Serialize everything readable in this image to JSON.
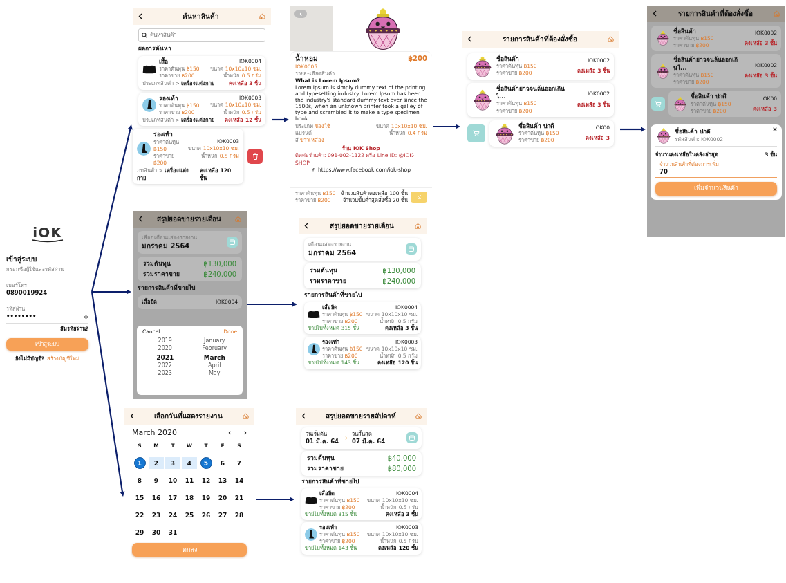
{
  "login": {
    "logo": "iOK",
    "title": "เข้าสู่ระบบ",
    "subtitle": "กรอกชื่อผู้ใช้และรหัสผ่าน",
    "phone_label": "เบอร์โทร",
    "phone": "0890019924",
    "password_label": "รหัสผ่าน",
    "password": "••••••••",
    "forgot": "ลืมรหัสผ่าน?",
    "button": "เข้าสู่ระบบ",
    "signup_text": "ยังไม่มีบัญชี?",
    "signup_link": "สร้างบัญชีใหม่"
  },
  "search_screen": {
    "title": "ค้นหาสินค้า",
    "search_placeholder": "ค้นหาสินค้า",
    "section": "ผลการค้นหา",
    "products": [
      {
        "kind": "shirt",
        "name": "เสื้อ",
        "code": "IOK0004",
        "cost_label": "ราคาต้นทุน",
        "cost": "฿150",
        "price_label": "ราคาขาย",
        "price": "฿200",
        "size_label": "ขนาด",
        "size": "10x10x10 ซม.",
        "weight_label": "น้ำหนัก",
        "weight": "0.5 กรัม",
        "category_label": "ประเภทสินค้า >",
        "category": "เครื่องแต่งกาย",
        "stock": "คงเหลือ 3 ชิ้น",
        "low_stock": true,
        "swiped": false
      },
      {
        "kind": "shoe",
        "name": "รองเท้า",
        "code": "IOK0003",
        "cost_label": "ราคาต้นทุน",
        "cost": "฿150",
        "price_label": "ราคาขาย",
        "price": "฿200",
        "size_label": "ขนาด",
        "size": "10x10x10 ซม.",
        "weight_label": "น้ำหนัก",
        "weight": "0.5 กรัม",
        "category_label": "ประเภทสินค้า >",
        "category": "เครื่องแต่งกาย",
        "stock": "คงเหลือ 12 ชิ้น",
        "low_stock": true,
        "swiped": false
      },
      {
        "kind": "shoe",
        "name": "รองเท้า",
        "code": "IOK0003",
        "cost_label": "ราคาต้นทุน",
        "cost": "฿150",
        "price_label": "ราคาขาย",
        "price": "฿200",
        "size_label": "ขนาด",
        "size": "10x10x10 ซม.",
        "weight_label": "น้ำหนัก",
        "weight": "0.5 กรัม",
        "category_label": "ภทสินค้า >",
        "category": "เครื่องแต่งกาย",
        "stock": "คงเหลือ 120 ชิ้น",
        "low_stock": false,
        "swiped": true
      }
    ]
  },
  "detail_screen": {
    "name": "น้ำหอม",
    "code": "IOK0005",
    "price": "฿200",
    "description_label": "รายละเอียดสินค้า",
    "description_title": "What is Lorem Ipsum?",
    "description": "Lorem Ipsum is simply dummy text of the printing and typesetting industry. Lorem Ipsum has been the industry's standard dummy text ever since the 1500s, when an unknown printer took a galley of type and scrambled it to make a type specimen book.",
    "type_label": "ประเภท",
    "type": "ของใช้",
    "brand_label": "แบรนด์",
    "variant_label": "สี",
    "variant": "ขาวเหลือง",
    "size_label": "ขนาด",
    "size": "10x10x10 ซม.",
    "weight_label": "น้ำหนัก",
    "weight": "0.4 กรัม",
    "shop": "ร้าน IOK Shop",
    "contact": "ติดต่อร้านค้า: 091-002-1122 หรือ Line ID: @IOK-SHOP",
    "facebook": "https://www.facebook.com/iok-shop",
    "cost_label": "ราคาต้นทุน",
    "cost": "฿150",
    "sale_label": "ราคาขาย",
    "sale": "฿200",
    "stock_text": "จำนวนสินค้าคงเหลือ 100 ชิ้น",
    "min_order_text": "จำนวนขั้นต่ำสุดสั่งซื้อ 20 ชิ้น"
  },
  "order_screen": {
    "title": "รายการสินค้าที่ต้องสั่งซื้อ",
    "items": [
      {
        "name": "ชื่อสินค้า",
        "code": "IOK0002",
        "cost_label": "ราคาต้นทุน",
        "cost": "฿150",
        "price_label": "ราคาขาย",
        "price": "฿200",
        "stock": "คงเหลือ 3 ชิ้น",
        "swiped": false
      },
      {
        "name": "ชื่อสินค้ายาวจนล้นออกเกินไ...",
        "code": "IOK0002",
        "cost_label": "ราคาต้นทุน",
        "cost": "฿150",
        "price_label": "ราคาขาย",
        "price": "฿200",
        "stock": "คงเหลือ 3 ชิ้น",
        "swiped": false
      },
      {
        "name": "ชื่อสินค้า ปกติ",
        "code": "IOK00",
        "cost_label": "ราคาต้นทุน",
        "cost": "฿150",
        "price_label": "ราคาขาย",
        "price": "฿200",
        "stock": "คงเหลือ 3",
        "swiped": true
      }
    ]
  },
  "restock_screen": {
    "title": "รายการสินค้าที่ต้องสั่งซื้อ",
    "items": [
      {
        "name": "ชื่อสินค้า",
        "code": "IOK0002",
        "cost_label": "ราคาต้นทุน",
        "cost": "฿150",
        "price_label": "ราคาขาย",
        "price": "฿200",
        "stock": "คงเหลือ 3 ชิ้น",
        "swiped": false
      },
      {
        "name": "ชื่อสินค้ายาวจนล้นออกเกินไ...",
        "code": "IOK0002",
        "cost_label": "ราคาต้นทุน",
        "cost": "฿150",
        "price_label": "ราคาขาย",
        "price": "฿200",
        "stock": "คงเหลือ 3 ชิ้น",
        "swiped": false
      },
      {
        "name": "ชื่อสินค้า ปกติ",
        "code": "IOK00",
        "cost_label": "ราคาต้นทุน",
        "cost": "฿150",
        "price_label": "ราคาขาย",
        "price": "฿200",
        "stock": "คงเหลือ 3",
        "swiped": true
      }
    ],
    "modal": {
      "name": "ชื่อสินค้า ปกติ",
      "code_text": "รหัสสินค้า: IOK0002",
      "stock_label": "จำนวนคงเหลือในคลังล่าสุด",
      "stock": "3 ชิ้น",
      "input_label": "จำนวนสินค้าที่ต้องการเพิ่ม",
      "input_value": "70",
      "button": "เพิ่มจำนวนสินค้า"
    }
  },
  "month_picker_screen": {
    "title": "สรุปยอดขายรายเดือน",
    "month_label": "เลือกเดือนแสดงรายงาน",
    "month": "มกราคม 2564",
    "cost_label": "รวมต้นทุน",
    "cost": "฿130,000",
    "sale_label": "รวมราคาขาย",
    "sale": "฿240,000",
    "section": "รายการสินค้าที่ขายไป",
    "peek_name": "เสื้อยืด",
    "peek_code": "IOK0004",
    "cancel": "Cancel",
    "done": "Done",
    "years": [
      {
        "label": "2019",
        "selected": false
      },
      {
        "label": "2020",
        "selected": false
      },
      {
        "label": "2021",
        "selected": true
      },
      {
        "label": "2022",
        "selected": false
      },
      {
        "label": "2023",
        "selected": false
      }
    ],
    "months": [
      {
        "label": "January",
        "selected": false
      },
      {
        "label": "February",
        "selected": false
      },
      {
        "label": "March",
        "selected": true
      },
      {
        "label": "April",
        "selected": false
      },
      {
        "label": "May",
        "selected": false
      }
    ]
  },
  "monthly_screen": {
    "title": "สรุปยอดขายรายเดือน",
    "month_label": "เดือนแสดงรายงาน",
    "month": "มกราคม 2564",
    "cost_label": "รวมต้นทุน",
    "cost": "฿130,000",
    "sale_label": "รวมราคาขาย",
    "sale": "฿240,000",
    "section": "รายการสินค้าที่ขายไป",
    "products": [
      {
        "kind": "shirt",
        "name": "เสื้อยืด",
        "code": "IOK0004",
        "cost_label": "ราคาต้นทุน",
        "cost": "฿150",
        "price_label": "ราคาขาย",
        "price": "฿200",
        "size_text": "ขนาด 10x10x10 ซม.",
        "weight_text": "น้ำหนัก 0.5 กรัม",
        "sold": "ขายไปทั้งหมด 315 ชิ้น",
        "stock": "คงเหลือ 3 ชิ้น"
      },
      {
        "kind": "shoe",
        "name": "รองเท้า",
        "code": "IOK0003",
        "cost_label": "ราคาต้นทุน",
        "cost": "฿150",
        "price_label": "ราคาขาย",
        "price": "฿200",
        "size_text": "ขนาด 10x10x10 ซม.",
        "weight_text": "น้ำหนัก 0.5 กรัม",
        "sold": "ขายไปทั้งหมด 143 ชิ้น",
        "stock": "คงเหลือ 120 ชิ้น"
      }
    ]
  },
  "date_screen": {
    "title": "เลือกวันที่แสดงรายงาน",
    "month": "March 2020",
    "prev": "‹",
    "next": "›",
    "weekdays": [
      "S",
      "M",
      "T",
      "W",
      "T",
      "F",
      "S"
    ],
    "button": "ตกลง",
    "days": [
      {
        "label": "1",
        "selected": true,
        "in_range": false
      },
      {
        "label": "2",
        "selected": false,
        "in_range": true
      },
      {
        "label": "3",
        "selected": false,
        "in_range": true
      },
      {
        "label": "4",
        "selected": false,
        "in_range": true
      },
      {
        "label": "5",
        "selected": true,
        "in_range": false
      },
      {
        "label": "6",
        "selected": false,
        "in_range": false
      },
      {
        "label": "7",
        "selected": false,
        "in_range": false
      },
      {
        "label": "8",
        "selected": false,
        "in_range": false
      },
      {
        "label": "9",
        "selected": false,
        "in_range": false
      },
      {
        "label": "10",
        "selected": false,
        "in_range": false
      },
      {
        "label": "11",
        "selected": false,
        "in_range": false
      },
      {
        "label": "12",
        "selected": false,
        "in_range": false
      },
      {
        "label": "13",
        "selected": false,
        "in_range": false
      },
      {
        "label": "14",
        "selected": false,
        "in_range": false
      },
      {
        "label": "15",
        "selected": false,
        "in_range": false
      },
      {
        "label": "16",
        "selected": false,
        "in_range": false
      },
      {
        "label": "17",
        "selected": false,
        "in_range": false
      },
      {
        "label": "18",
        "selected": false,
        "in_range": false
      },
      {
        "label": "19",
        "selected": false,
        "in_range": false
      },
      {
        "label": "20",
        "selected": false,
        "in_range": false
      },
      {
        "label": "21",
        "selected": false,
        "in_range": false
      },
      {
        "label": "22",
        "selected": false,
        "in_range": false
      },
      {
        "label": "23",
        "selected": false,
        "in_range": false
      },
      {
        "label": "24",
        "selected": false,
        "in_range": false
      },
      {
        "label": "25",
        "selected": false,
        "in_range": false
      },
      {
        "label": "26",
        "selected": false,
        "in_range": false
      },
      {
        "label": "27",
        "selected": false,
        "in_range": false
      },
      {
        "label": "28",
        "selected": false,
        "in_range": false
      },
      {
        "label": "29",
        "selected": false,
        "in_range": false
      },
      {
        "label": "30",
        "selected": false,
        "in_range": false
      },
      {
        "label": "31",
        "selected": false,
        "in_range": false
      }
    ]
  },
  "weekly_screen": {
    "title": "สรุปยอดขายรายสัปดาห์",
    "start_label": "วันเริ่มต้น",
    "start": "01 มี.ค. 64",
    "end_label": "วันสิ้นสุด",
    "end": "07 มี.ค. 64",
    "cost_label": "รวมต้นทุน",
    "cost": "฿40,000",
    "sale_label": "รวมราคาขาย",
    "sale": "฿80,000",
    "section": "รายการสินค้าที่ขายไป",
    "products": [
      {
        "kind": "shirt",
        "name": "เสื้อยืด",
        "code": "IOK0004",
        "cost_label": "ราคาต้นทุน",
        "cost": "฿150",
        "price_label": "ราคาขาย",
        "price": "฿200",
        "size_text": "ขนาด 10x10x10 ซม.",
        "weight_text": "น้ำหนัก 0.5 กรัม",
        "sold": "ขายไปทั้งหมด 315 ชิ้น",
        "stock": "คงเหลือ 3 ชิ้น"
      },
      {
        "kind": "shoe",
        "name": "รองเท้า",
        "code": "IOK0003",
        "cost_label": "ราคาต้นทุน",
        "cost": "฿150",
        "price_label": "ราคาขาย",
        "price": "฿200",
        "size_text": "ขนาด 10x10x10 ซม.",
        "weight_text": "น้ำหนัก 0.5 กรัม",
        "sold": "ขายไปทั้งหมด 143 ชิ้น",
        "stock": "คงเหลือ 120 ชิ้น"
      }
    ]
  }
}
